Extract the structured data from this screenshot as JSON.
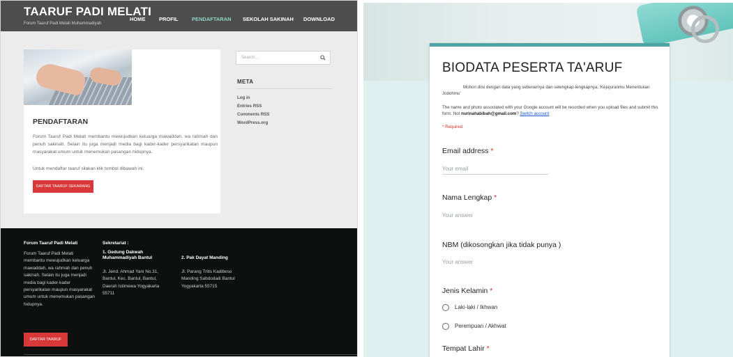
{
  "site": {
    "brand": "TAARUF PADI MELATI",
    "tagline": "Forum Taaruf Padi Melati Muhammadiyah",
    "nav": [
      "HOME",
      "PROFIL",
      "PENDAFTARAN",
      "SEKOLAH SAKINAH",
      "DOWNLOAD"
    ],
    "active_nav": "PENDAFTARAN",
    "card": {
      "title": "PENDAFTARAN",
      "text": "Forum Taaruf Padi Melati membantu mewujudkan keluarga mawaddah, wa rahmah dan penuh sakinah. Selain itu juga menjadi media bagi kader-kader persyarikatan maupun masyarakat umum untuk menemukan pasangan hidupnya.",
      "text2": "Untuk mendaftar taaruf silakan klik tombol dibawah ini.",
      "button": "DAFTAR TAARUF SEKARANG"
    },
    "sidebar": {
      "search_placeholder": "Search ...",
      "meta_title": "META",
      "meta_links": [
        "Log in",
        "Entries RSS",
        "Comments RSS",
        "WordPress.org"
      ]
    },
    "footer": {
      "col1_title": "Forum Taaruf Padi Melati",
      "col1_text": "Forum Taaruf Padi Melati membantu mewujudkan keluarga mawaddah, wa rahmah dan penuh sakinah. Selain itu juga menjadi media bagi kader-kader persyarikatan maupun masyarakat umum untuk menemukan pasangan hidupnya.",
      "col2_title": "Sekretariat :",
      "col2_sub": "1. Gedung Dakwah Muhammadiyah Bantul",
      "col2_text": "Jl. Jend. Ahmad Yani No.31, Bantul, Kec. Bantul, Bantul, Daerah Istimewa Yogyakarta 55711",
      "col3_sub": "2. Pak Dayat Manding",
      "col3_text": "Jl. Parang Tritis Kadibeso Manding Sabdodadi Bantul Yogyakarta 55715",
      "button": "DAFTAR TAARUF"
    }
  },
  "form": {
    "title": "BIODATA PESERTA TA'ARUF",
    "description": "Mohon diisi dengan data yang sebenarnya dan selengkap-lengkapnya, 'Kejujuranmu Menentukan Jodohmu'",
    "notice_pre": "The name and photo associated with your Google account will be recorded when you upload files and submit this form. Not ",
    "notice_email": "nurinahabibah@gmail.com",
    "notice_q": "?",
    "switch_account": "Switch account",
    "required": "* Required",
    "q_email_label": "Email address",
    "q_email_placeholder": "Your email",
    "q_nama_label": "Nama Lengkap",
    "q_nbm_label": "NBM (dikosongkan jika tidak punya )",
    "answer_placeholder": "Your answer",
    "q_jenis_label": "Jenis Kelamin",
    "option_1": "Laki-laki / Ikhwan",
    "option_2": "Perempuan / Akhwat",
    "q_tempat_label": "Tempat Lahir",
    "star": "*"
  }
}
